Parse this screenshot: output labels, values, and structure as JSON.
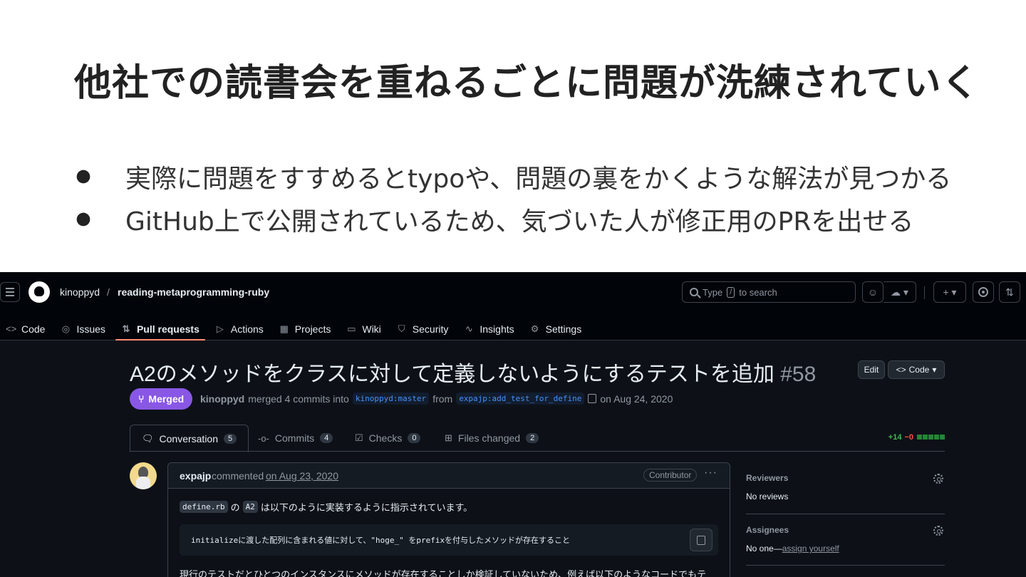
{
  "slide": {
    "title": "他社での読書会を重ねるごとに問題が洗練されていく",
    "bullets": [
      "実際に問題をすすめるとtypoや、問題の裏をかくような解法が見つかる",
      "GitHub上で公開されているため、気づいた人が修正用のPRを出せる"
    ]
  },
  "github": {
    "owner": "kinoppyd",
    "separator": "/",
    "repo": "reading-metaprogramming-ruby",
    "search": {
      "prefix": "Type",
      "key": "/",
      "suffix": "to search"
    },
    "nav": [
      {
        "label": "Code",
        "icon": "code-icon",
        "glyph": "<>"
      },
      {
        "label": "Issues",
        "icon": "issue-icon",
        "glyph": "◎"
      },
      {
        "label": "Pull requests",
        "icon": "pull-request-icon",
        "glyph": "⇅",
        "active": true
      },
      {
        "label": "Actions",
        "icon": "play-icon",
        "glyph": "▷"
      },
      {
        "label": "Projects",
        "icon": "table-icon",
        "glyph": "▦"
      },
      {
        "label": "Wiki",
        "icon": "book-icon",
        "glyph": "▭"
      },
      {
        "label": "Security",
        "icon": "shield-icon",
        "glyph": "⛉"
      },
      {
        "label": "Insights",
        "icon": "graph-icon",
        "glyph": "∿"
      },
      {
        "label": "Settings",
        "icon": "gear-icon",
        "glyph": "⚙"
      }
    ],
    "pr": {
      "title": "A2のメソッドをクラスに対して定義しないようにするテストを追加",
      "number": "#58",
      "edit_label": "Edit",
      "code_label": "Code",
      "status": "Merged",
      "author": "kinoppyd",
      "merged_text": "merged 4 commits into",
      "base_branch": "kinoppyd:master",
      "from_text": "from",
      "head_branch": "expajp:add_test_for_define",
      "date_text": "on Aug 24, 2020",
      "status_color": "#8957e5"
    },
    "tabs": [
      {
        "label": "Conversation",
        "count": "5",
        "icon": "comment-icon",
        "glyph": "🗨"
      },
      {
        "label": "Commits",
        "count": "4",
        "icon": "commit-icon",
        "glyph": "-o-"
      },
      {
        "label": "Checks",
        "count": "0",
        "icon": "checklist-icon",
        "glyph": "☑"
      },
      {
        "label": "Files changed",
        "count": "2",
        "icon": "file-diff-icon",
        "glyph": "⊞"
      }
    ],
    "diffstat": {
      "additions": "+14",
      "deletions": "−0"
    },
    "comment": {
      "author": "expajp",
      "verb": "commented",
      "date": "on Aug 23, 2020",
      "badge": "Contributor",
      "more": "···",
      "code1": "define.rb",
      "text1": "の",
      "code2": "A2",
      "text2": "は以下のように実装するように指示されています。",
      "quote": "initializeに渡した配列に含まれる値に対して、\"hoge_\" をprefixを付与したメソッドが存在すること",
      "line3": "現行のテストだとひとつのインスタンスにメソッドが存在することしか検証していないため、例えば以下のようなコードでもテ"
    },
    "sidebar": {
      "reviewers_title": "Reviewers",
      "reviewers_value": "No reviews",
      "assignees_title": "Assignees",
      "assignees_value": "No one—",
      "assignees_link": "assign yourself"
    }
  }
}
